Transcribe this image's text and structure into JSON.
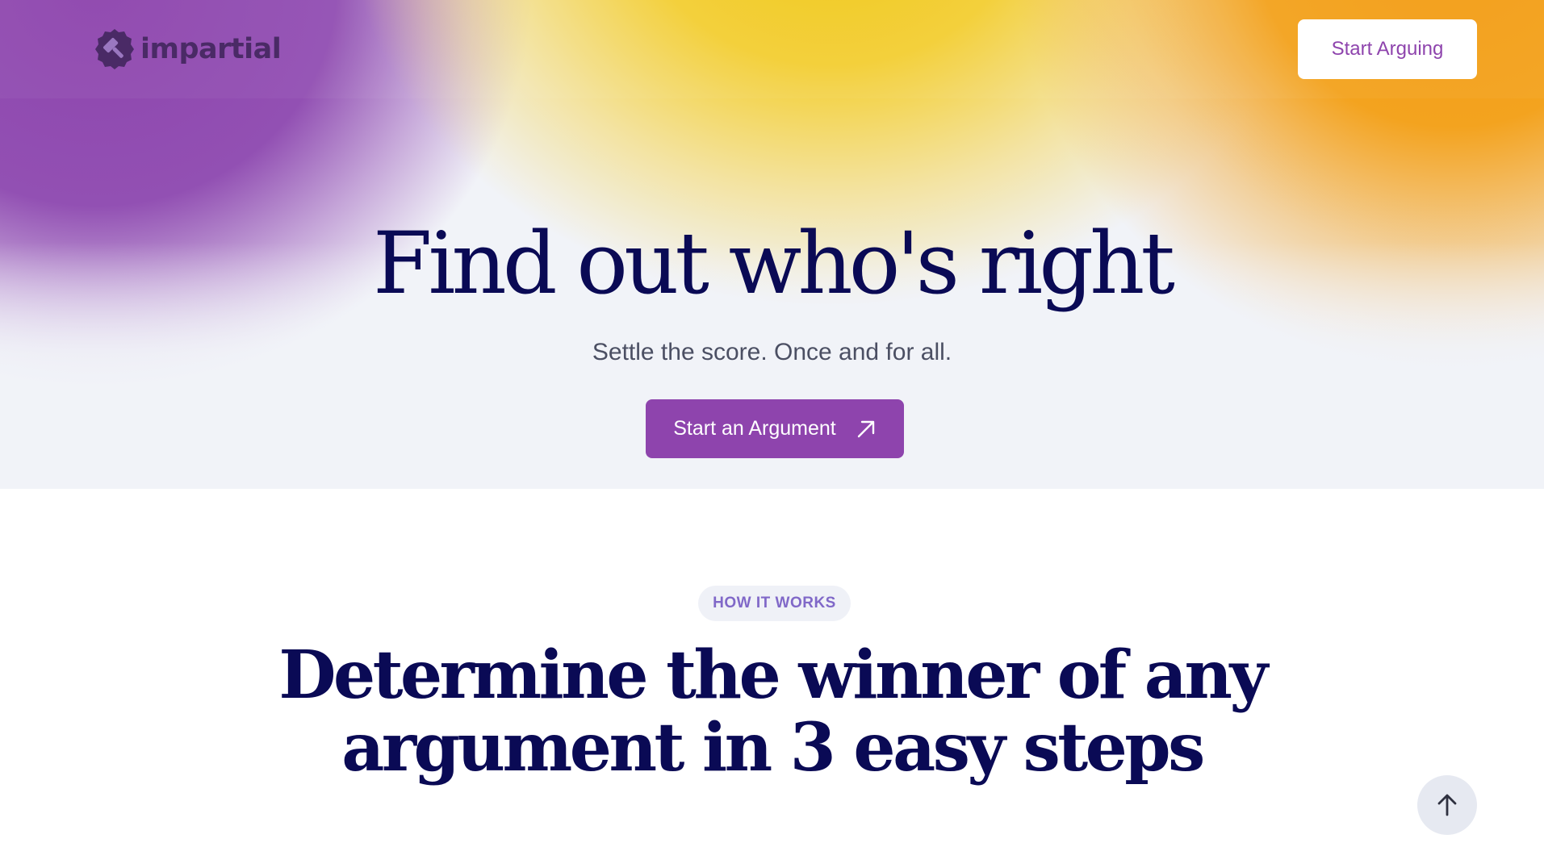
{
  "nav": {
    "logo_text": "impartial",
    "cta_label": "Start Arguing"
  },
  "hero": {
    "title": "Find out who's right",
    "subtitle": "Settle the score. Once and for all.",
    "cta_label": "Start an Argument"
  },
  "how_it_works": {
    "badge": "HOW IT WORKS",
    "title_line1": "Determine the winner of any",
    "title_line2": "argument in 3 easy steps"
  },
  "icons": {
    "logo": "gavel-badge-icon",
    "cta_arrow": "arrow-up-right-icon",
    "scroll_top": "arrow-up-icon"
  },
  "colors": {
    "brand_purple": "#8e44ad",
    "accent_yellow": "#f1c40f",
    "accent_orange": "#f39c12",
    "heading_navy": "#0a0a55"
  }
}
